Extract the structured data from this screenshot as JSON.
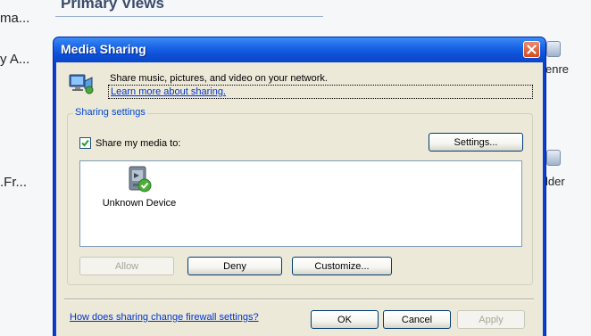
{
  "background": {
    "heading": "Primary Views",
    "left_items": [
      "ma...",
      "y A...",
      ".Fr..."
    ],
    "right_items": [
      "enre",
      "lder"
    ]
  },
  "dialog": {
    "title": "Media Sharing",
    "description": "Share music, pictures, and video on your network.",
    "learn_link": "Learn more about sharing.",
    "group_label": "Sharing settings",
    "share_checkbox": {
      "label": "Share my media to:",
      "checked": true
    },
    "settings_button": "Settings...",
    "devices": [
      {
        "name": "Unknown Device",
        "icon": "media-device-icon"
      }
    ],
    "allow_button": "Allow",
    "deny_button": "Deny",
    "customize_button": "Customize...",
    "firewall_link": "How does sharing change firewall settings?",
    "ok_button": "OK",
    "cancel_button": "Cancel",
    "apply_button": "Apply"
  },
  "colors": {
    "titlebar": "#0c4fd6",
    "client": "#ece9d8",
    "link": "#0033cc",
    "group_label": "#0046d5",
    "close_button": "#d44a1e"
  }
}
